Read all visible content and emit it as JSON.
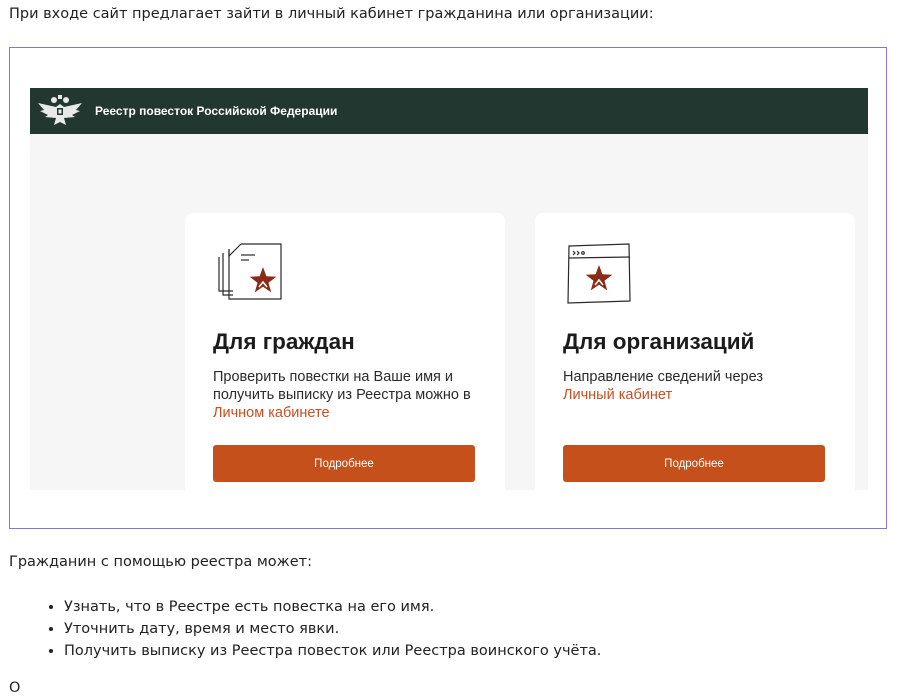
{
  "article": {
    "intro": "При входе сайт предлагает зайти в личный кабинет гражданина или организации:",
    "citizen_capabilities_intro": "Гражданин с помощью реестра может:",
    "citizen_capabilities": [
      "Узнать, что в Реестре есть повестка на его имя.",
      "Уточнить дату, время и место явки.",
      "Получить выписку из Реестра повесток или Реестра воинского учёта."
    ],
    "cut_off_line": "О"
  },
  "embedded_screenshot": {
    "site_title": "Реестр повесток Российской Федерации",
    "cards": [
      {
        "title": "Для граждан",
        "text": "Проверить повестки на Ваше имя и получить выписку из Реестра можно в ",
        "link": "Личном кабинете",
        "button": "Подробнее"
      },
      {
        "title": "Для организаций",
        "text": "Направление сведений через ",
        "link": "Личный кабинет",
        "button": "Подробнее"
      }
    ]
  },
  "colors": {
    "header_bg": "#22372f",
    "accent": "#c5501c",
    "link": "#c94e20",
    "star": "#8a2b17",
    "frame_border": "#8a73d6"
  },
  "icons": {
    "emblem": "double-headed-eagle-emblem-icon",
    "citizen_card": "document-star-icon",
    "organization_card": "browser-window-star-icon"
  }
}
